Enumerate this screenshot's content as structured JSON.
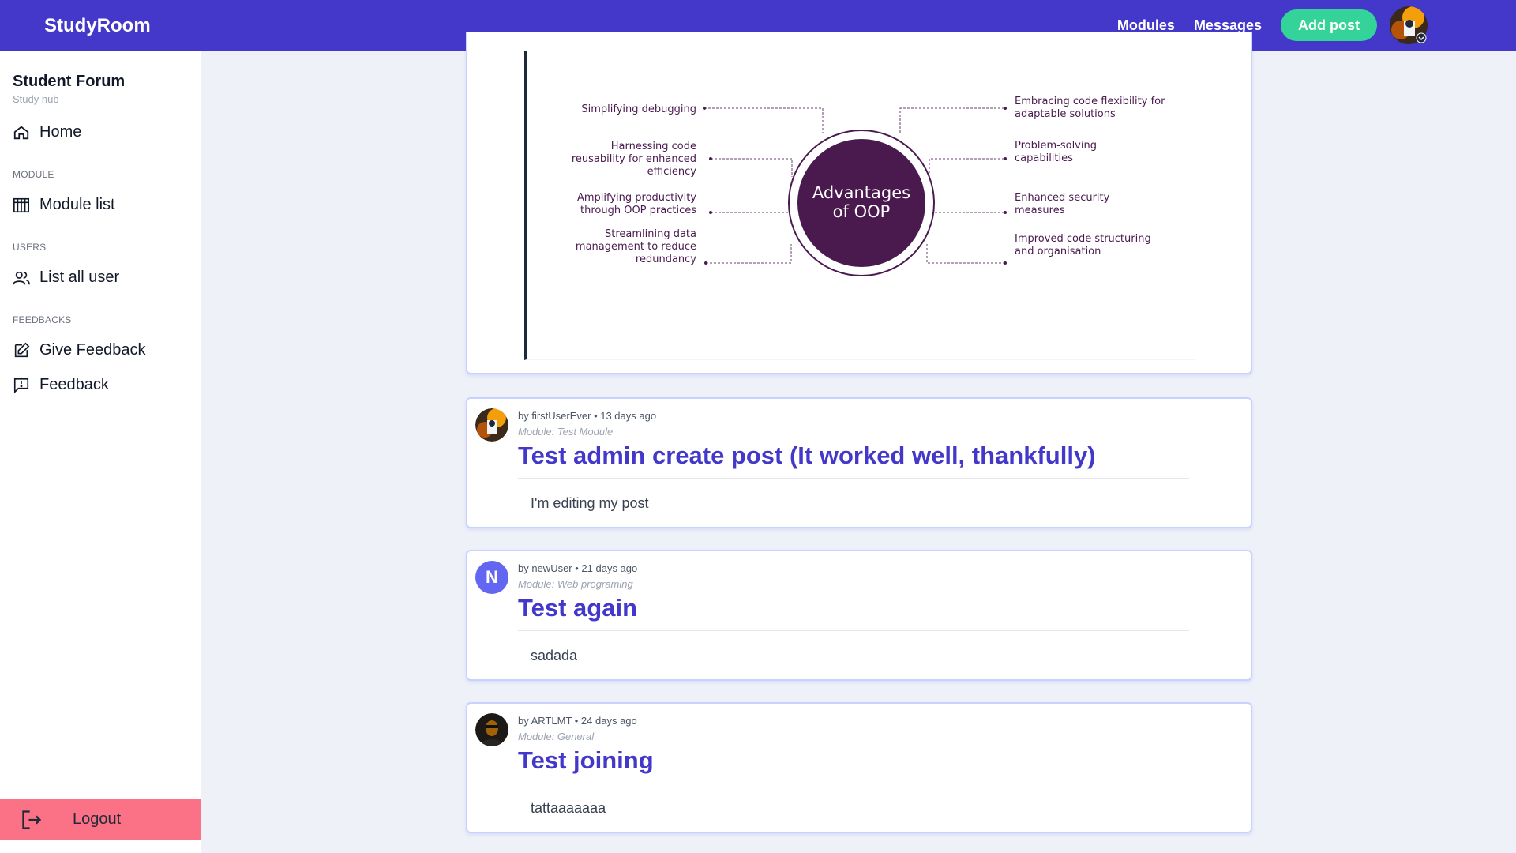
{
  "header": {
    "brand": "StudyRoom",
    "nav": [
      "Modules",
      "Messages"
    ],
    "add_post": "Add post"
  },
  "sidebar": {
    "title": "Student Forum",
    "subtitle": "Study hub",
    "home": "Home",
    "module_section": "MODULE",
    "module_list": "Module list",
    "users_section": "USERS",
    "list_users": "List all user",
    "feedbacks_section": "FEEDBACKS",
    "give_feedback": "Give Feedback",
    "feedback": "Feedback",
    "logout": "Logout"
  },
  "oop_image": {
    "center": [
      "Advantages",
      "of OOP"
    ],
    "left": [
      [
        "Simplifying debugging"
      ],
      [
        "Harnessing code",
        "reusability for enhanced",
        "efficiency"
      ],
      [
        "Amplifying productivity",
        "through OOP practices"
      ],
      [
        "Streamlining data",
        "management to reduce",
        "redundancy"
      ]
    ],
    "right": [
      [
        "Embracing code flexibility for",
        "adaptable solutions"
      ],
      [
        "Problem-solving",
        "capabilities"
      ],
      [
        "Enhanced security",
        "measures"
      ],
      [
        "Improved code structuring",
        "and organisation"
      ]
    ]
  },
  "posts": [
    {
      "meta": "by firstUserEver • 13 days ago",
      "module": "Module: Test Module",
      "title": "Test admin create post (It worked well, thankfully)",
      "body": "I'm editing my post"
    },
    {
      "avatar_letter": "N",
      "meta": "by newUser • 21 days ago",
      "module": "Module: Web programing",
      "title": "Test again",
      "body": "sadada"
    },
    {
      "meta": "by ARTLMT • 24 days ago",
      "module": "Module: General",
      "title": "Test joining",
      "body": "tattaaaaaaa"
    }
  ],
  "colors": {
    "primary": "#4338ca",
    "accent": "#34d399",
    "logout": "#fb7185",
    "oop_circle": "#4a1a4f"
  }
}
